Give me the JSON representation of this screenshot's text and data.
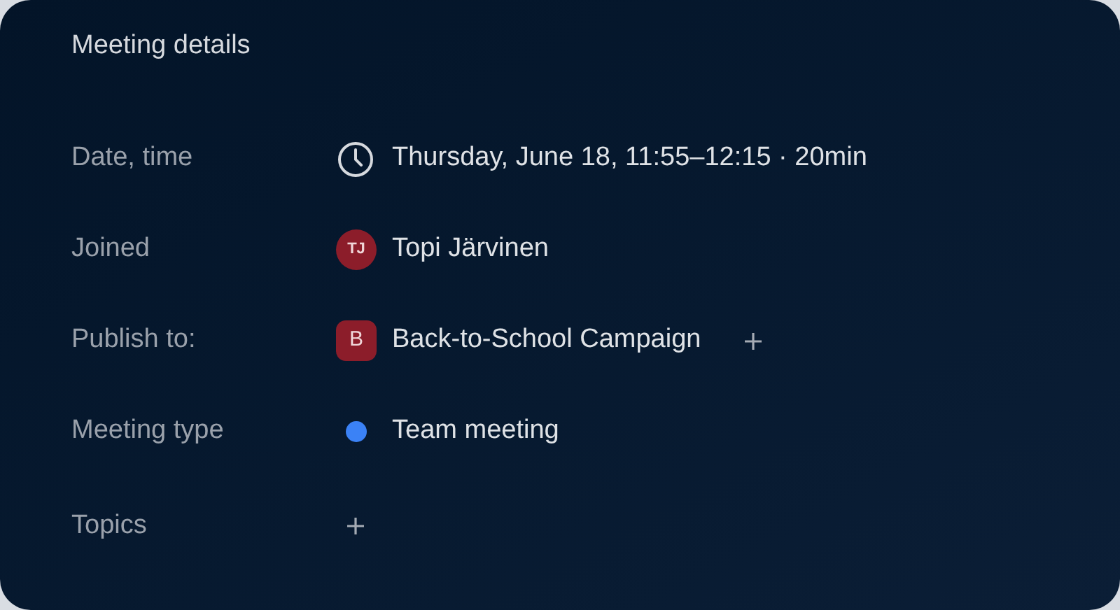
{
  "title": "Meeting details",
  "rows": [
    {
      "label": "Date, time",
      "kind": "time",
      "value": "Thursday, June 18, 11:55–12:15 · 20min"
    },
    {
      "label": "Joined",
      "kind": "person",
      "initials": "TJ",
      "value": "Topi Järvinen"
    },
    {
      "label": "Publish to:",
      "kind": "project",
      "initials": "B",
      "value": "Back-to-School Campaign",
      "addable": true
    },
    {
      "label": "Meeting type",
      "kind": "type",
      "color": "#3b82f6",
      "value": "Team meeting"
    },
    {
      "label": "Topics",
      "kind": "empty",
      "addable": true
    }
  ]
}
